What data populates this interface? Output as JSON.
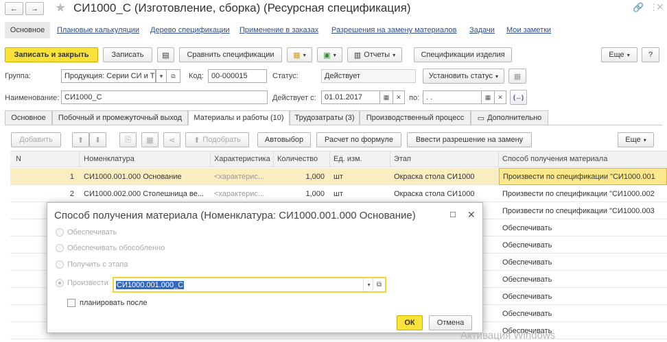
{
  "window": {
    "title": "СИ1000_С (Изготовление, сборка) (Ресурсная спецификация)"
  },
  "nav": {
    "tabs": [
      "Основное",
      "Плановые калькуляции",
      "Дерево спецификации",
      "Применение в заказах",
      "Разрешения на замену материалов",
      "Задачи",
      "Мои заметки"
    ]
  },
  "toolbar": {
    "save_close": "Записать и закрыть",
    "save": "Записать",
    "compare": "Сравнить спецификации",
    "reports": "Отчеты",
    "product_specs": "Спецификации изделия",
    "more": "Еще",
    "help": "?"
  },
  "form": {
    "group_label": "Группа:",
    "group_value": "Продукция: Серии СИ и Т",
    "code_label": "Код:",
    "code_value": "00-000015",
    "status_label": "Статус:",
    "status_value": "Действует",
    "set_status": "Установить статус",
    "name_label": "Наименование:",
    "name_value": "СИ1000_С",
    "valid_from_label": "Действует с:",
    "valid_from_value": "01.01.2017",
    "to_label": "по:",
    "to_value": " .  .",
    "link_btn": "(↔)"
  },
  "tabs": [
    "Основное",
    "Побочный и промежуточный выход",
    "Материалы и работы (10)",
    "Трудозатраты (3)",
    "Производственный процесс",
    "Дополнительно"
  ],
  "table_toolbar": {
    "add": "Добавить",
    "pick": "Подобрать",
    "autoselect": "Автовыбор",
    "formula": "Расчет по формуле",
    "replace": "Ввести разрешение на замену",
    "more": "Еще"
  },
  "table": {
    "headers": [
      "N",
      "Номенклатура",
      "Характеристика",
      "Количество",
      "Ед. изм.",
      "Этап",
      "Способ получения материала"
    ],
    "rows": [
      {
        "n": "1",
        "item": "СИ1000.001.000 Основание",
        "char": "<характерис...",
        "qty": "1,000",
        "unit": "шт",
        "stage": "Окраска стола СИ1000",
        "method": "Произвести по спецификации \"СИ1000.001"
      },
      {
        "n": "2",
        "item": "СИ1000.002.000 Столешница ве...",
        "char": "<характерис...",
        "qty": "1,000",
        "unit": "шт",
        "stage": "Окраска стола СИ1000",
        "method": "Произвести по спецификации \"СИ1000.002"
      },
      {
        "n": "",
        "item": "",
        "char": "",
        "qty": "",
        "unit": "",
        "stage": "",
        "method": "Произвести по спецификации \"СИ1000.003"
      },
      {
        "n": "",
        "item": "",
        "char": "",
        "qty": "",
        "unit": "",
        "stage": "",
        "method": "Обеспечивать"
      },
      {
        "n": "",
        "item": "",
        "char": "",
        "qty": "",
        "unit": "",
        "stage": "",
        "method": "Обеспечивать"
      },
      {
        "n": "",
        "item": "",
        "char": "",
        "qty": "",
        "unit": "",
        "stage": "",
        "method": "Обеспечивать"
      },
      {
        "n": "",
        "item": "",
        "char": "",
        "qty": "",
        "unit": "",
        "stage": "",
        "method": "Обеспечивать"
      },
      {
        "n": "",
        "item": "",
        "char": "",
        "qty": "",
        "unit": "",
        "stage": "",
        "method": "Обеспечивать"
      },
      {
        "n": "",
        "item": "",
        "char": "",
        "qty": "",
        "unit": "",
        "stage": "",
        "method": "Обеспечивать"
      },
      {
        "n": "",
        "item": "",
        "char": "",
        "qty": "",
        "unit": "",
        "stage": "",
        "method": "Обеспечивать"
      }
    ]
  },
  "dialog": {
    "title": "Способ получения материала (Номенклатура: СИ1000.001.000 Основание)",
    "options": [
      "Обеспечивать",
      "Обеспечивать обособленно",
      "Получить с этапа",
      "Произвести"
    ],
    "produce_value": "СИ1000.001.000_С",
    "plan_after": "планировать после",
    "ok": "ОК",
    "cancel": "Отмена"
  },
  "watermark": "Активация Windows"
}
